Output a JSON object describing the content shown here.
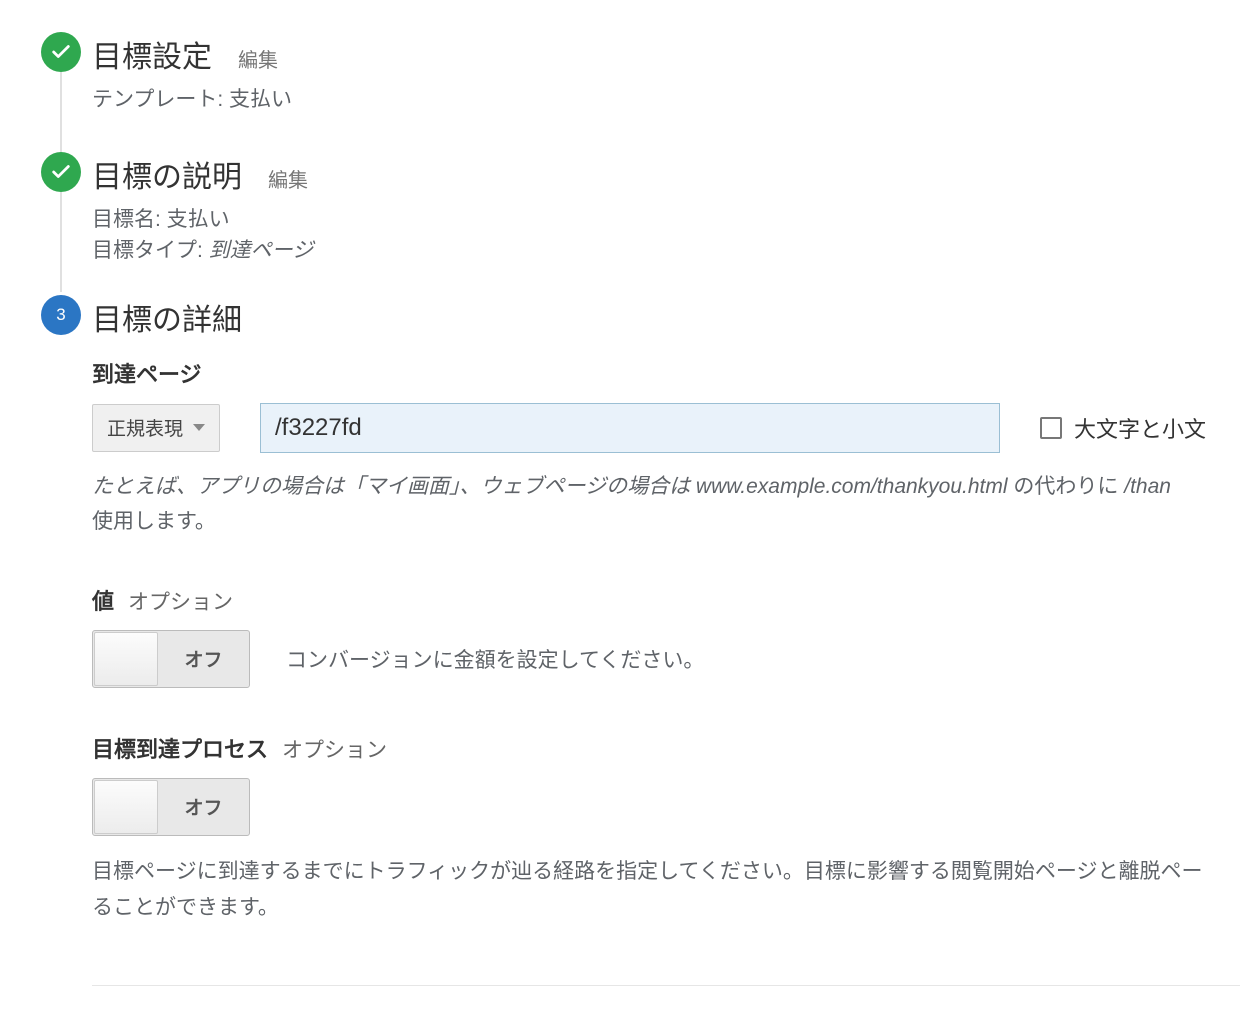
{
  "step1": {
    "title": "目標設定",
    "edit": "編集",
    "template_prefix": "テンプレート: ",
    "template_value": "支払い"
  },
  "step2": {
    "title": "目標の説明",
    "edit": "編集",
    "name_prefix": "目標名: ",
    "name_value": "支払い",
    "type_prefix": "目標タイプ: ",
    "type_value": "到達ページ"
  },
  "step3": {
    "number": "3",
    "title": "目標の詳細",
    "destination": {
      "label": "到達ページ",
      "match_type": "正規表現",
      "input_value": "/f3227fd",
      "case_label": "大文字と小文",
      "helper_a": "たとえば、アプリの場合は「マイ画面」、ウェブページの場合は ",
      "helper_b": "www.example.com/thankyou.html",
      "helper_c": " の代わりに ",
      "helper_d": "/than",
      "helper_e": "使用します。"
    },
    "value": {
      "label": "値",
      "optional": "オプション",
      "toggle_state": "オフ",
      "desc": "コンバージョンに金額を設定してください。"
    },
    "funnel": {
      "label": "目標到達プロセス",
      "optional": "オプション",
      "toggle_state": "オフ",
      "desc": "目標ページに到達するまでにトラフィックが辿る経路を指定してください。目標に影響する閲覧開始ページと離脱ペー",
      "desc2": "ることができます。"
    }
  }
}
